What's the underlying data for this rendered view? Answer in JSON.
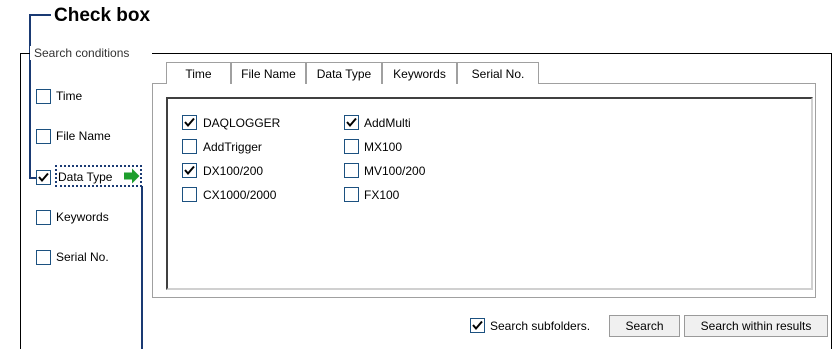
{
  "annotation": {
    "title": "Check box"
  },
  "group": {
    "label": "Search conditions"
  },
  "left_options": [
    {
      "label": "Time",
      "checked": false
    },
    {
      "label": "File Name",
      "checked": false
    },
    {
      "label": "Data Type",
      "checked": true
    },
    {
      "label": "Keywords",
      "checked": false
    },
    {
      "label": "Serial No.",
      "checked": false
    }
  ],
  "arrow_color": "#1d9e2c",
  "tabs": [
    {
      "label": "Time"
    },
    {
      "label": "File Name"
    },
    {
      "label": "Data Type",
      "active": true
    },
    {
      "label": "Keywords"
    },
    {
      "label": "Serial No."
    }
  ],
  "data_types": {
    "col1": [
      {
        "label": "DAQLOGGER",
        "checked": true
      },
      {
        "label": "AddTrigger",
        "checked": false
      },
      {
        "label": "DX100/200",
        "checked": true
      },
      {
        "label": "CX1000/2000",
        "checked": false
      }
    ],
    "col2": [
      {
        "label": "AddMulti",
        "checked": true
      },
      {
        "label": "MX100",
        "checked": false
      },
      {
        "label": "MV100/200",
        "checked": false
      },
      {
        "label": "FX100",
        "checked": false
      }
    ]
  },
  "footer": {
    "subfolders_label": "Search subfolders.",
    "subfolders_checked": true,
    "search_label": "Search",
    "search_within_label": "Search within results"
  }
}
